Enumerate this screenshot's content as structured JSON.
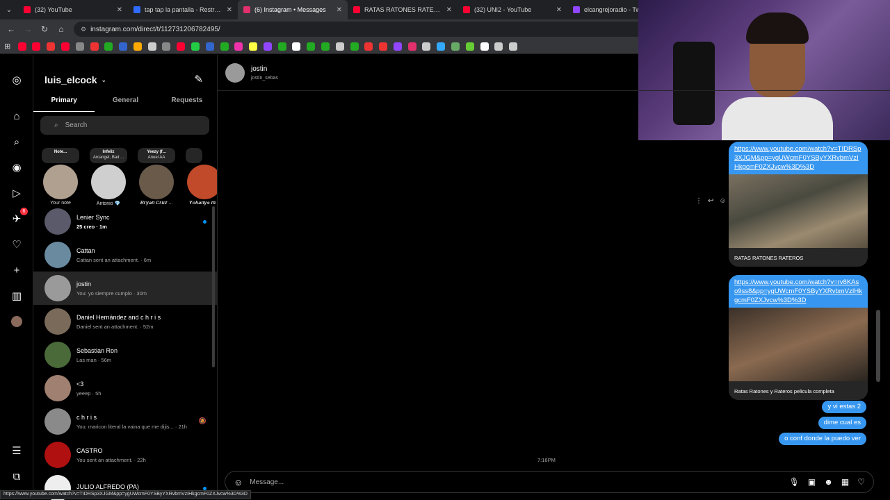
{
  "browser": {
    "tabs": [
      {
        "title": "(32) YouTube",
        "color": "#ff0033",
        "active": false
      },
      {
        "title": "tap tap la pantalla - Restream",
        "color": "#2f6bff",
        "active": false
      },
      {
        "title": "(6) Instagram • Messages",
        "color": "#e1306c",
        "active": true
      },
      {
        "title": "RATAS RATONES RATEROS - Yo",
        "color": "#ff0033",
        "active": false
      },
      {
        "title": "(32) UNI2 - YouTube",
        "color": "#ff0033",
        "active": false
      },
      {
        "title": "elcangrejoradio - Twitc",
        "color": "#9146ff",
        "active": false
      }
    ],
    "url": "instagram.com/direct/t/112731206782495/",
    "status_url": "https://www.youtube.com/watch?v=TIDRSp3XJGM&pp=ygUWcmF0YSByYXRvbmVzIHkgcmF0ZXJvcw%3D%3D"
  },
  "inbox": {
    "username": "luis_elcock",
    "tabs": [
      "Primary",
      "General",
      "Requests"
    ],
    "search_placeholder": "Search",
    "notes": [
      {
        "bubble_top": "Note...",
        "bubble_bottom": "",
        "name": "Your note"
      },
      {
        "bubble_top": "Infeliz",
        "bubble_bottom": "Arcangel, Bad ...",
        "name": "Antonio 💎"
      },
      {
        "bubble_top": "Yeezy (f...",
        "bubble_bottom": "Anuel AA",
        "name": "𝑩𝒓𝒚𝒂𝒏 𝑪𝒓𝒖𝒛 ..."
      },
      {
        "bubble_top": "",
        "bubble_bottom": "",
        "name": "𝒀𝒐𝒉𝒂𝒏𝒚𝒔 𝒎..."
      }
    ],
    "conversations": [
      {
        "name": "Lenier Sync",
        "preview": "25 creo · 1m",
        "unread": true,
        "muted": false,
        "selected": false
      },
      {
        "name": "Cattan",
        "preview": "Cattan sent an attachment. · 6m",
        "unread": false,
        "muted": false,
        "selected": false
      },
      {
        "name": "jostin",
        "preview": "You: yo siempre cumplo · 30m",
        "unread": false,
        "muted": false,
        "selected": true
      },
      {
        "name": "Daniel Hernández and c h r i s",
        "preview": "Daniel sent an attachment. · 52m",
        "unread": false,
        "muted": false,
        "selected": false
      },
      {
        "name": "Sebastian Ron",
        "preview": "Las man · 56m",
        "unread": false,
        "muted": false,
        "selected": false
      },
      {
        "name": "<3",
        "preview": "yeeep · 5h",
        "unread": false,
        "muted": false,
        "selected": false
      },
      {
        "name": "c h r i s",
        "preview": "You: maricon literal la vaina que me dijis... · 21h",
        "unread": false,
        "muted": true,
        "selected": false
      },
      {
        "name": "CASTRO",
        "preview": "You sent an attachment. · 22h",
        "unread": false,
        "muted": false,
        "selected": false
      },
      {
        "name": "JULIO ALFREDO (PA)",
        "preview": "",
        "unread": true,
        "muted": false,
        "selected": false
      }
    ]
  },
  "rail": {
    "notification_count": "6"
  },
  "chat": {
    "name": "jostin",
    "username": "jostin_sebas",
    "cards": [
      {
        "link": "https://www.youtube.com/watch?v=TIDRSp3XJGM&pp=ygUWcmF0YSByYXRvbmVzIHkgcmF0ZXJvcw%3D%3D",
        "caption": "RATAS RATONES RATEROS"
      },
      {
        "link": "https://www.youtube.com/watch?v=rv8KAso9ss8&pp=ygUWcmF0YSByYXRvbmVzIHkgcmF0ZXJvcw%3D%3D",
        "caption": "Ratas Ratones y Rateros pelicula completa"
      }
    ],
    "messages": [
      "y vi estas 2",
      "dime cual es",
      "o conf donde la puedo ver"
    ],
    "time": "7:16PM",
    "composer_placeholder": "Message..."
  }
}
